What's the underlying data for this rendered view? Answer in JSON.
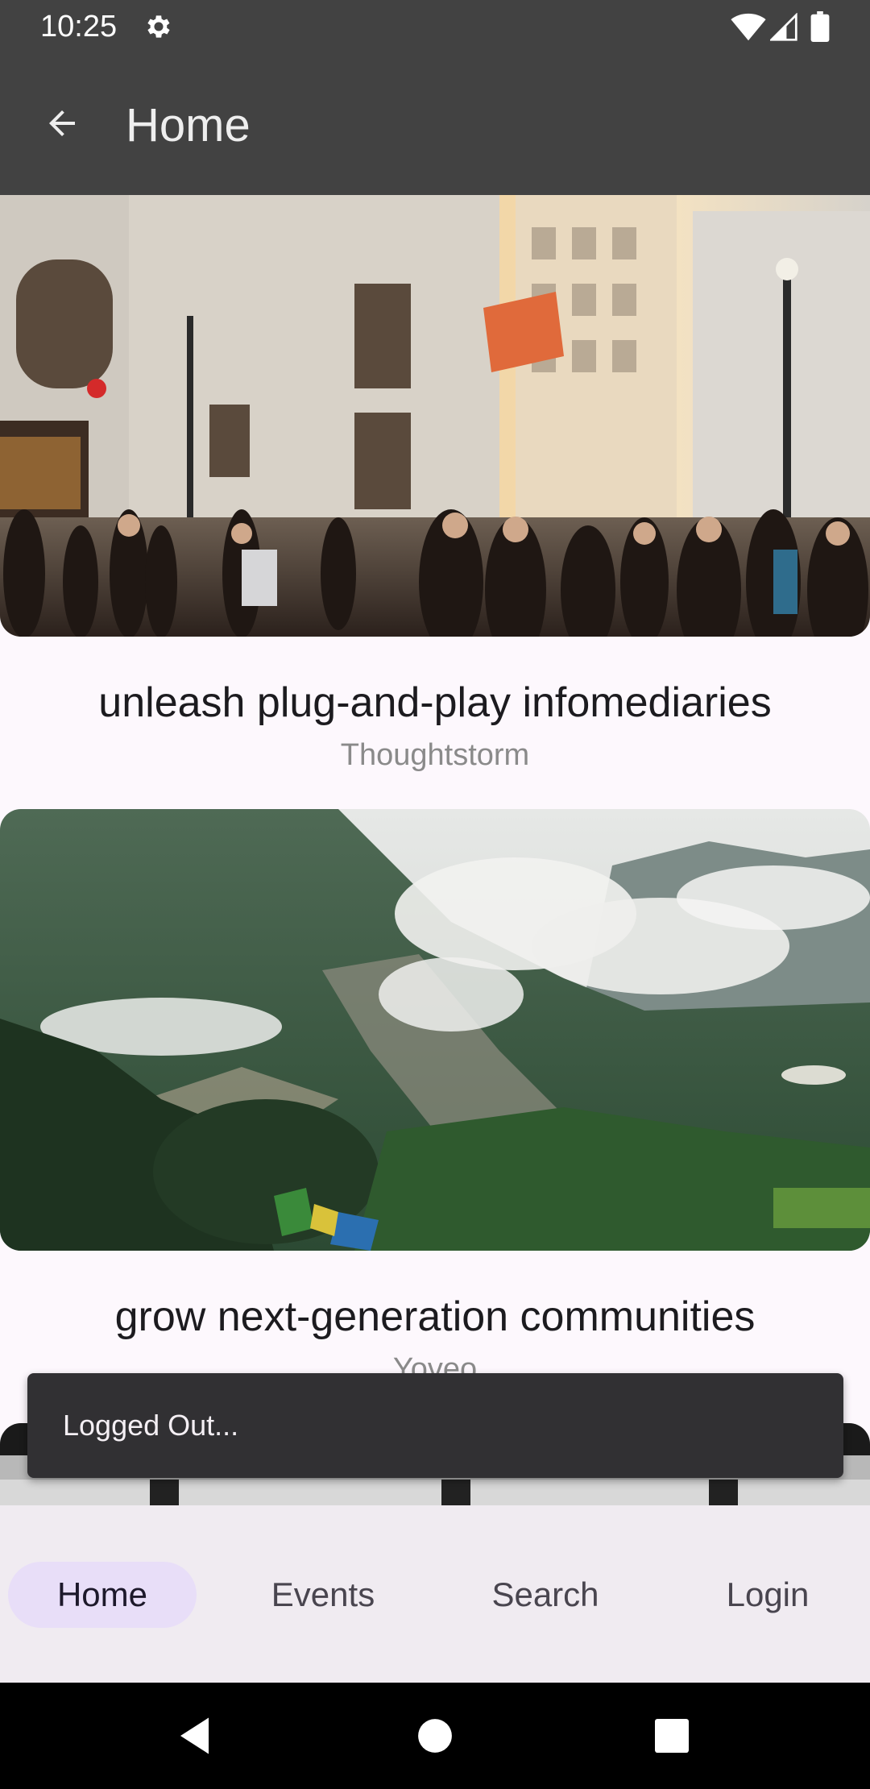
{
  "status_bar": {
    "time": "10:25",
    "icons": [
      "gear-icon",
      "wifi-icon",
      "signal-icon",
      "battery-icon"
    ]
  },
  "app_bar": {
    "title": "Home",
    "back_icon": "arrow-back-icon"
  },
  "feed": {
    "items": [
      {
        "title": "unleash plug-and-play infomediaries",
        "subtitle": "Thoughtstorm",
        "image": "city-street-crowd-photo"
      },
      {
        "title": "grow next-generation communities",
        "subtitle": "Yoveo",
        "image": "misty-mountain-valley-photo"
      },
      {
        "title": "",
        "subtitle": "",
        "image": "dark-window-photo"
      }
    ]
  },
  "snackbar": {
    "message": "Logged Out..."
  },
  "bottom_nav": {
    "items": [
      {
        "label": "Home",
        "active": true
      },
      {
        "label": "Events",
        "active": false
      },
      {
        "label": "Search",
        "active": false
      },
      {
        "label": "Login",
        "active": false
      }
    ]
  },
  "system_nav": {
    "icons": [
      "back-triangle-icon",
      "home-circle-icon",
      "recents-square-icon"
    ]
  },
  "colors": {
    "app_bar": "#424242",
    "background": "#fdf8fd",
    "nav_background": "#f0ebf1",
    "nav_active_pill": "#e8def8",
    "snackbar": "#313033"
  }
}
